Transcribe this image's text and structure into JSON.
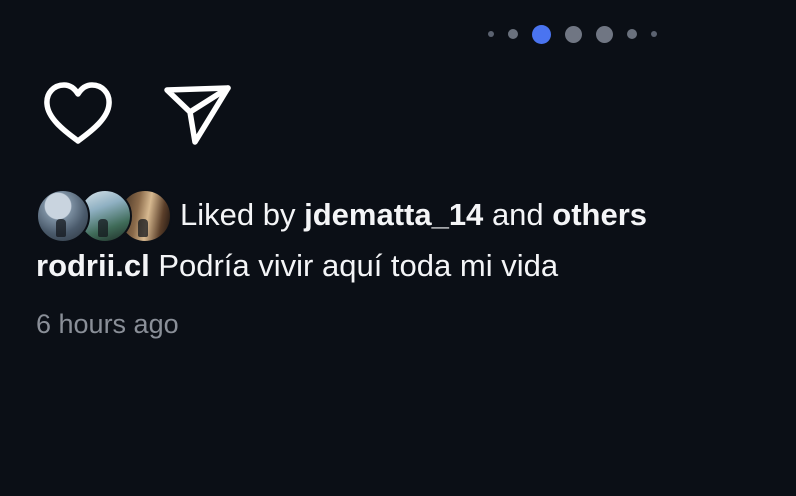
{
  "carousel": {
    "total_dots": 7,
    "active_index": 2
  },
  "actions": {
    "like_icon": "heart-outline",
    "share_icon": "paper-plane-outline"
  },
  "likes": {
    "prefix": "Liked by",
    "first_user": "jdematta_14",
    "conjunction": "and",
    "others": "others"
  },
  "post": {
    "username": "rodrii.cl",
    "caption": "Podría vivir aquí toda mi vida",
    "timestamp": "6 hours ago"
  },
  "colors": {
    "background": "#0b0f16",
    "active_dot": "#4a74f0",
    "muted_text": "#8a8f98"
  }
}
